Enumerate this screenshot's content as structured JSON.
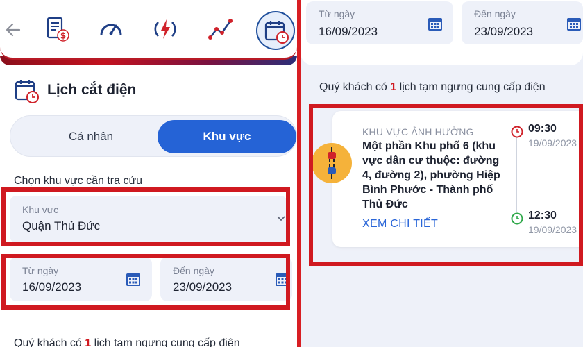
{
  "left": {
    "section_title": "Lịch cắt điện",
    "segments": [
      "Cá nhân",
      "Khu vực"
    ],
    "area_prompt": "Chọn khu vực cần tra cứu",
    "area_field": {
      "label": "Khu vực",
      "value": "Quận Thủ Đức"
    },
    "from_date": {
      "label": "Từ ngày",
      "value": "16/09/2023"
    },
    "to_date": {
      "label": "Đến ngày",
      "value": "23/09/2023"
    },
    "note_prefix": "Quý khách có",
    "note_count": "1",
    "note_suffix": "lịch tạm ngưng cung cấp điện"
  },
  "right": {
    "from_date": {
      "label": "Từ ngày",
      "value": "16/09/2023"
    },
    "to_date": {
      "label": "Đến ngày",
      "value": "23/09/2023"
    },
    "note_prefix": "Quý khách có",
    "note_count": "1",
    "note_suffix": "lịch tạm ngưng cung cấp điện",
    "outage": {
      "area_heading": "KHU VỰC ẢNH HƯỞNG",
      "area_description": "Một phần Khu phố 6 (khu vực dân cư thuộc: đường 4, đường 2), phường Hiệp Bình Phước - Thành phố Thủ Đức",
      "detail_link": "XEM CHI TIẾT",
      "start_time": "09:30",
      "start_date": "19/09/2023",
      "end_time": "12:30",
      "end_date": "19/09/2023"
    }
  },
  "icons": [
    "back-arrow-icon",
    "bill-icon",
    "speedometer-icon",
    "power-icon",
    "chart-line-icon",
    "calendar-clock-icon"
  ],
  "colors": {
    "accent_blue": "#2563d6",
    "highlight_red": "#d01920",
    "field_bg": "#eef1f9"
  }
}
